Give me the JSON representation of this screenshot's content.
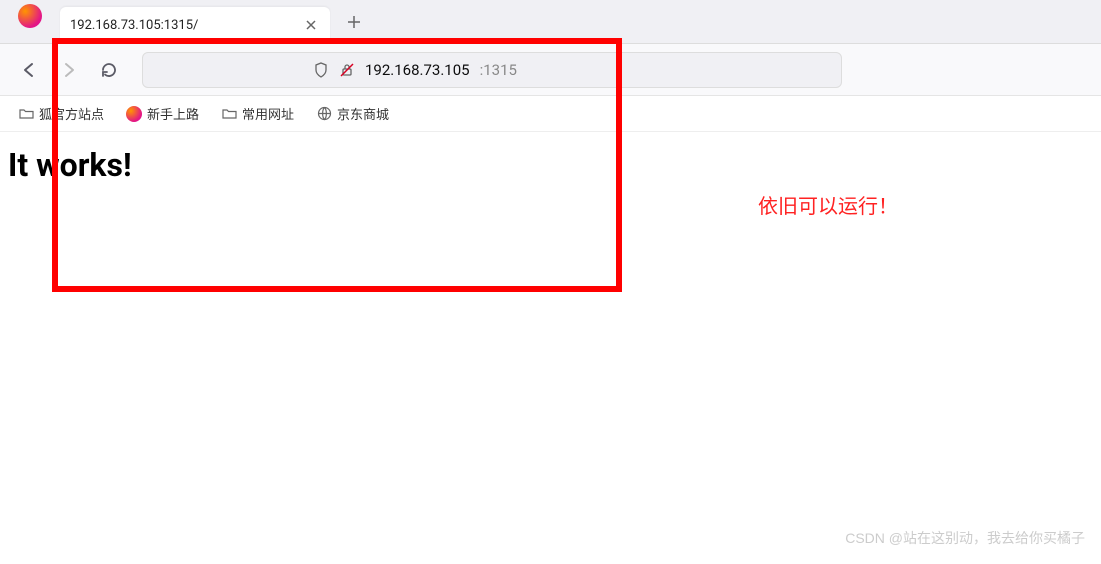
{
  "tab": {
    "title": "192.168.73.105:1315/"
  },
  "url": {
    "host": "192.168.73.105",
    "port": ":1315"
  },
  "bookmarks": [
    {
      "label": "狐官方站点",
      "icon": "folder"
    },
    {
      "label": "新手上路",
      "icon": "firefox"
    },
    {
      "label": "常用网址",
      "icon": "folder"
    },
    {
      "label": "京东商城",
      "icon": "globe"
    }
  ],
  "page": {
    "heading": "It works!"
  },
  "annotation": "依旧可以运行！",
  "watermark": "CSDN @站在这别动，我去给你买橘子"
}
